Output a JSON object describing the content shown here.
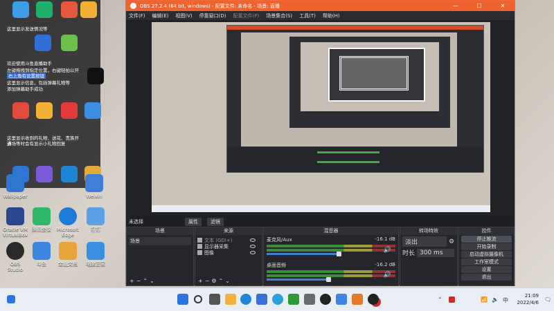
{
  "desktop": {
    "helper": {
      "title": "这里显示发送情况等",
      "line1": "欢迎使用斗鱼直播助手",
      "line2": "左键拖拽到指定位置，右键轻拍以开始录制。",
      "line3": "右上角有设置按钮",
      "line4": "这里显示信息，包括弹幕礼物等",
      "line5": "添加弹幕助手成功",
      "line6": "这里显示收到的礼物、送花、贵族开通",
      "line7": "进场等时会有显示小礼物回复"
    },
    "icons": [
      {
        "label": "Wallpaper",
        "color": "#2f76d2"
      },
      {
        "label": "Weixin",
        "color": "#3f7fd9"
      },
      {
        "label": "Oracle VM VirtualBox",
        "color": "#28478e"
      },
      {
        "label": "腾讯会议",
        "color": "#2fb86a"
      },
      {
        "label": "Microsoft Edge",
        "color": "#1e7ad6"
      },
      {
        "label": "钉钉",
        "color": "#5aa1e8"
      },
      {
        "label": "OBS Studio",
        "color": "#2a2a2a"
      },
      {
        "label": "斗鱼",
        "color": "#3c85e0"
      },
      {
        "label": "金山文档",
        "color": "#e8a33a"
      },
      {
        "label": "电脑管家",
        "color": "#3a8fe3"
      }
    ]
  },
  "obs": {
    "title": "OBS 27.2.4 (64 bit, windows) - 配置文件: 未命名 - 场景: 直播",
    "menu": [
      "文件(F)",
      "编辑(E)",
      "视图(V)",
      "停靠窗口(D)",
      "配置文件(P)",
      "场景集合(S)",
      "工具(T)",
      "帮助(H)"
    ],
    "scenebar": {
      "label": "未选择",
      "props": "属性",
      "filters": "滤镜"
    },
    "docks": {
      "scenes": {
        "title": "场景",
        "items": [
          "场景"
        ]
      },
      "sources": {
        "title": "来源",
        "items": [
          {
            "name": "文本 (GDI+)"
          },
          {
            "name": "显示器采集"
          },
          {
            "name": "图像"
          }
        ]
      },
      "mixer": {
        "title": "混音器",
        "channels": [
          {
            "name": "麦克风/Aux",
            "db": "-16.1 dB",
            "level": 0.7
          },
          {
            "name": "桌面音频",
            "db": "-16.2 dB",
            "level": 0.6
          }
        ]
      },
      "transitions": {
        "title": "转场特效",
        "type": "淡出",
        "duration_label": "时长",
        "duration": "300 ms"
      },
      "controls": {
        "title": "控件",
        "buttons": [
          "停止推流",
          "开始录制",
          "启动虚拟摄像机",
          "工作室模式",
          "设置",
          "退出"
        ]
      }
    }
  },
  "taskbar": {
    "time": "21:09",
    "date": "2022/4/6",
    "lang": "中",
    "icons": [
      {
        "name": "start",
        "color": "#2a76e0"
      },
      {
        "name": "search",
        "color": "#333"
      },
      {
        "name": "taskview",
        "color": "#444"
      },
      {
        "name": "explorer",
        "color": "#f0b43c"
      },
      {
        "name": "edge",
        "color": "#1e86d6"
      },
      {
        "name": "store",
        "color": "#3a6fd8"
      },
      {
        "name": "xbox",
        "color": "#2d9a3a"
      },
      {
        "name": "settings",
        "color": "#555"
      },
      {
        "name": "obs",
        "color": "#222"
      },
      {
        "name": "douyu",
        "color": "#3c85e0"
      },
      {
        "name": "app",
        "color": "#e07a2a"
      },
      {
        "name": "obs-recording",
        "color": "#d22a2a"
      }
    ]
  }
}
